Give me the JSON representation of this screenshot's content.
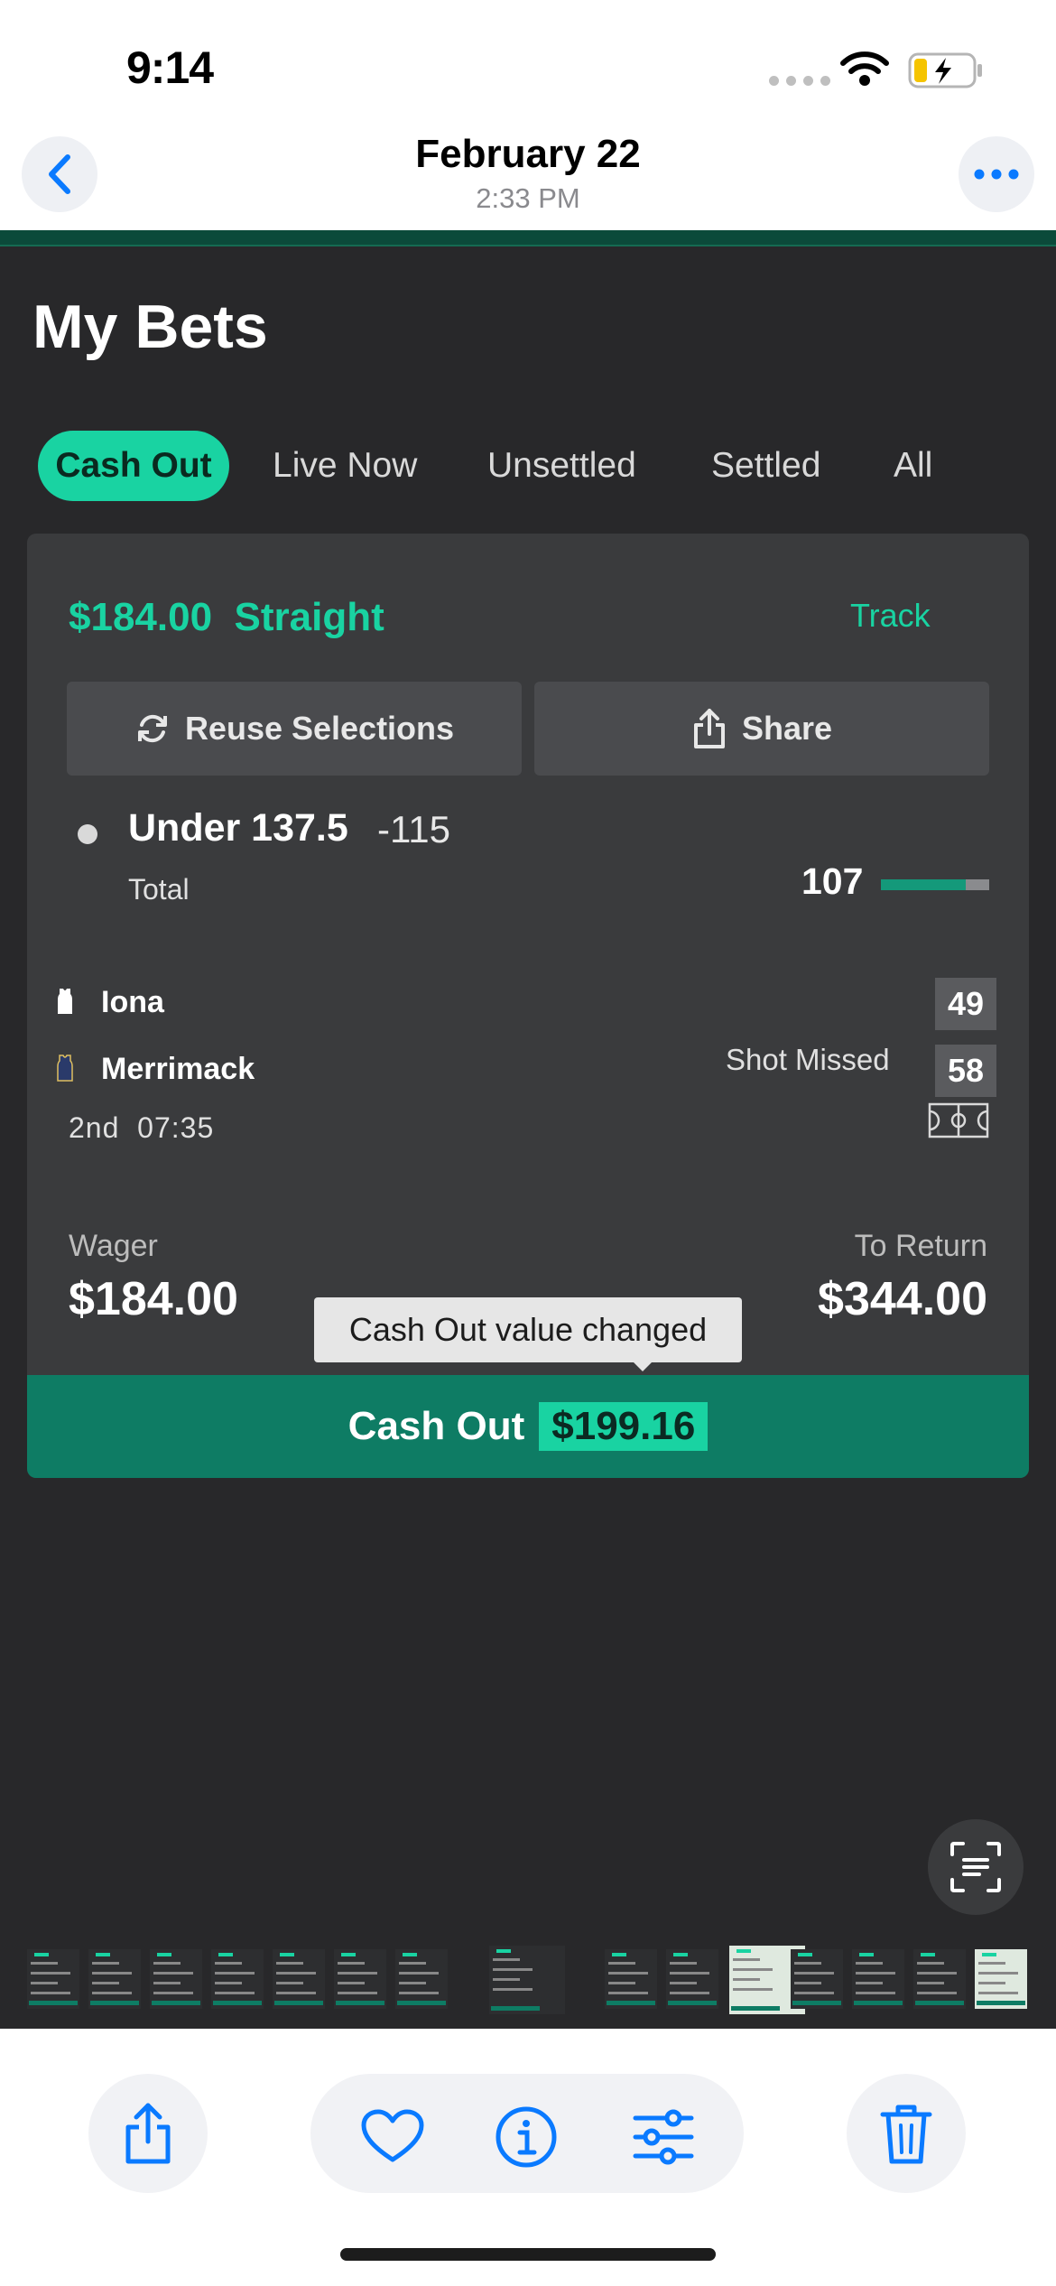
{
  "status_bar": {
    "time": "9:14"
  },
  "viewer": {
    "date": "February 22",
    "time": "2:33 PM"
  },
  "app": {
    "title": "My Bets",
    "filters": [
      "Cash Out",
      "Live Now",
      "Unsettled",
      "Settled",
      "All"
    ],
    "active_filter": "Cash Out",
    "bet": {
      "amount": "$184.00",
      "type": "Straight",
      "track_label": "Track",
      "reuse_label": "Reuse Selections",
      "share_label": "Share",
      "selection": "Under 137.5",
      "odds": "-115",
      "market": "Total",
      "current_total": "107",
      "total_progress_fraction": 0.78,
      "team1": {
        "name": "Iona",
        "score": "49"
      },
      "team2": {
        "name": "Merrimack",
        "score": "58",
        "event": "Shot Missed"
      },
      "period": "2nd",
      "clock": "07:35",
      "wager_label": "Wager",
      "wager": "$184.00",
      "return_label": "To Return",
      "to_return": "$344.00",
      "tooltip": "Cash Out value changed",
      "cashout_label": "Cash Out",
      "cashout_value": "$199.16"
    }
  },
  "colors": {
    "accent": "#19d3a2",
    "cashout_bar": "#0e7c64",
    "card_bg": "#3a3b3d",
    "app_bg": "#28282a",
    "ios_blue": "#0a7aff"
  },
  "icons": [
    "back-chevron-icon",
    "more-icon",
    "refresh-icon",
    "share-icon",
    "jersey-icon",
    "court-icon",
    "live-text-icon",
    "heart-icon",
    "info-icon",
    "adjust-icon",
    "trash-icon"
  ]
}
